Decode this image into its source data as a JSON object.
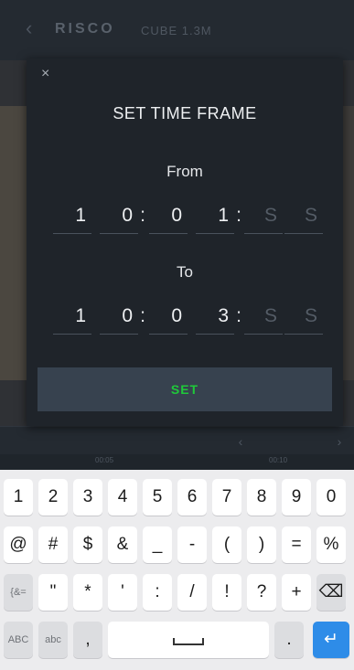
{
  "app": {
    "brand": "RISCO",
    "device": "CUBE 1.3M"
  },
  "timeline": {
    "ticks": [
      "00:05",
      "00:10"
    ]
  },
  "modal": {
    "title": "SET TIME FRAME",
    "close_symbol": "×",
    "from_label": "From",
    "to_label": "To",
    "from_digits": [
      "1",
      "0",
      "0",
      "1",
      "S",
      "S"
    ],
    "to_digits": [
      "1",
      "0",
      "0",
      "3",
      "S",
      "S"
    ],
    "separator": ":",
    "set_label": "SET"
  },
  "keyboard": {
    "row1": [
      "1",
      "2",
      "3",
      "4",
      "5",
      "6",
      "7",
      "8",
      "9",
      "0"
    ],
    "row2": [
      "@",
      "#",
      "$",
      "&",
      "_",
      "-",
      "(",
      ")",
      "=",
      "%"
    ],
    "row3": [
      "{&=",
      "\"",
      "*",
      "'",
      ":",
      "/",
      "!",
      "?",
      "+",
      "⌫"
    ],
    "row4": [
      "ABC",
      "abc",
      ",",
      "",
      ".",
      "↵"
    ]
  },
  "colors": {
    "set_text": "#1fc93a",
    "modal_bg": "#1f242a",
    "enter_key": "#2e8ce8"
  },
  "icons": {
    "back": "chevron-left-icon",
    "close": "close-icon",
    "backspace": "backspace-icon",
    "enter": "enter-icon"
  }
}
